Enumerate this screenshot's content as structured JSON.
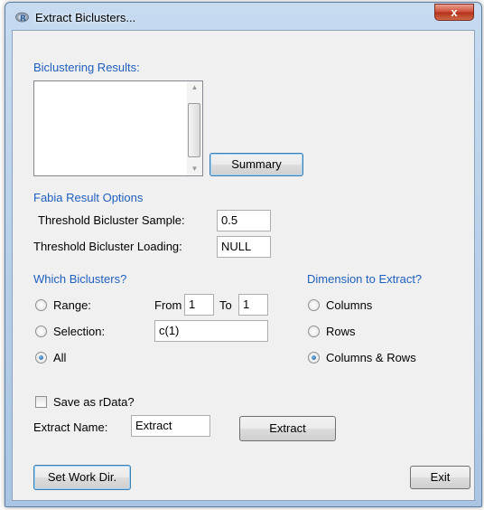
{
  "window": {
    "title": "Extract Biclusters...",
    "close_glyph": "x",
    "app_icon": "r-logo-icon"
  },
  "results": {
    "heading": "Biclustering Results:",
    "summary_button": "Summary"
  },
  "fabia": {
    "heading": "Fabia Result Options",
    "threshold_sample_label": "Threshold Bicluster Sample:",
    "threshold_sample_value": "0.5",
    "threshold_loading_label": "Threshold Bicluster Loading:",
    "threshold_loading_value": "NULL"
  },
  "which": {
    "heading": "Which Biclusters?",
    "range_label": "Range:",
    "from_label": "From",
    "from_value": "1",
    "to_label": "To",
    "to_value": "1",
    "selection_label": "Selection:",
    "selection_value": "c(1)",
    "all_label": "All",
    "selected": "All"
  },
  "dimension": {
    "heading": "Dimension to Extract?",
    "columns_label": "Columns",
    "rows_label": "Rows",
    "both_label": "Columns & Rows",
    "selected": "Columns & Rows"
  },
  "save": {
    "checkbox_label": "Save as rData?",
    "checked": false,
    "extract_name_label": "Extract Name:",
    "extract_name_value": "Extract",
    "extract_button": "Extract"
  },
  "footer": {
    "workdir_button": "Set Work Dir.",
    "exit_button": "Exit"
  },
  "colors": {
    "heading_blue": "#1f5fbf",
    "dialog_bg": "#f0f0f0",
    "radio_selected": "#1d5a9a"
  }
}
